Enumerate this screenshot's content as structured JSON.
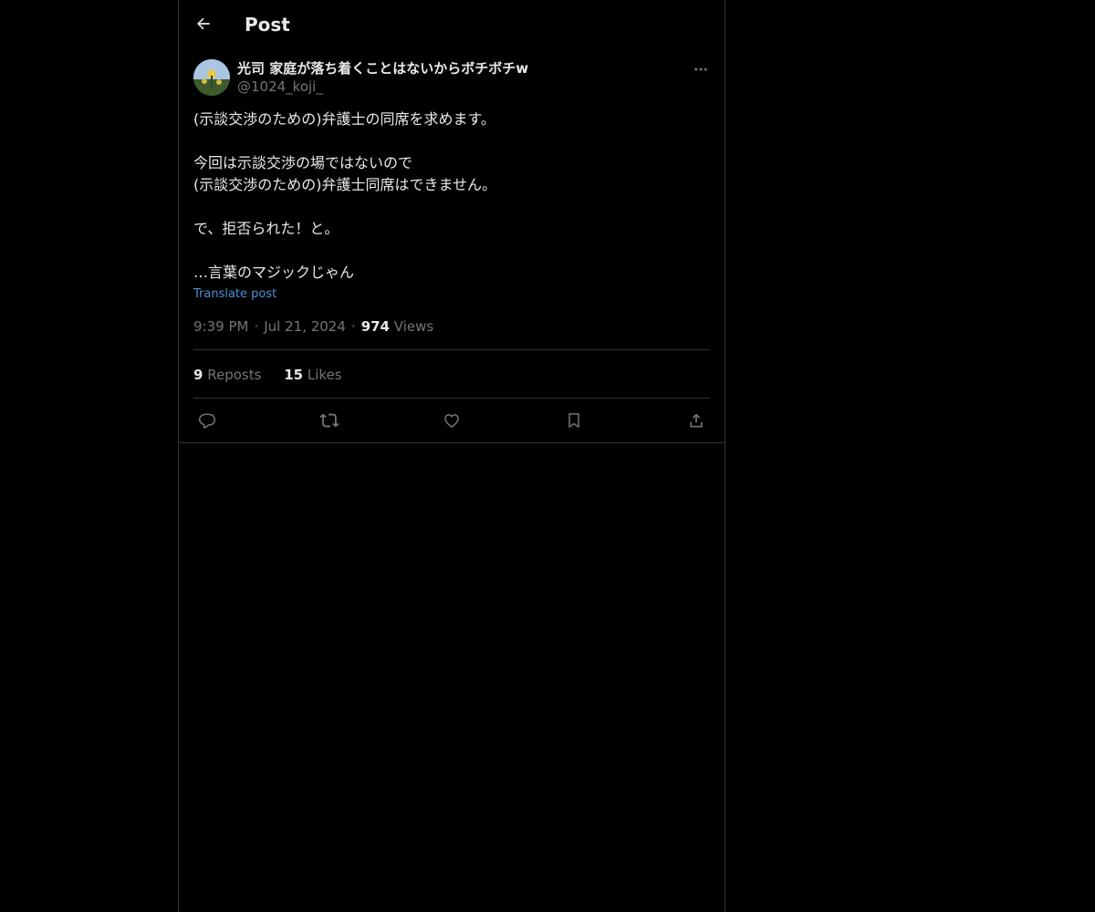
{
  "header": {
    "title": "Post",
    "back_icon": "arrow-left-icon"
  },
  "post": {
    "author": {
      "name": "光司 家庭が落ち着くことはないからボチボチw",
      "handle": "@1024_koji_"
    },
    "body": {
      "line1": "(示談交渉のための)弁護士の同席を求めます。",
      "line2": "今回は示談交渉の場ではないので",
      "line3": "(示談交渉のための)弁護士同席はできません。",
      "line4": "で、拒否られた！と。",
      "line5": "…言葉のマジックじゃん"
    },
    "translate_label": "Translate post",
    "time": "9:39 PM",
    "separator": "·",
    "date": "Jul 21, 2024",
    "views_count": "974",
    "views_label": "Views",
    "stats": {
      "reposts_count": "9",
      "reposts_label": "Reposts",
      "likes_count": "15",
      "likes_label": "Likes"
    },
    "actions": [
      "reply-icon",
      "repost-icon",
      "like-icon",
      "bookmark-icon",
      "share-icon"
    ]
  },
  "colors": {
    "background": "#000000",
    "text_primary": "#e7e9ea",
    "text_secondary": "#71767b",
    "link": "#4d8fd6",
    "border": "#2f3336"
  }
}
